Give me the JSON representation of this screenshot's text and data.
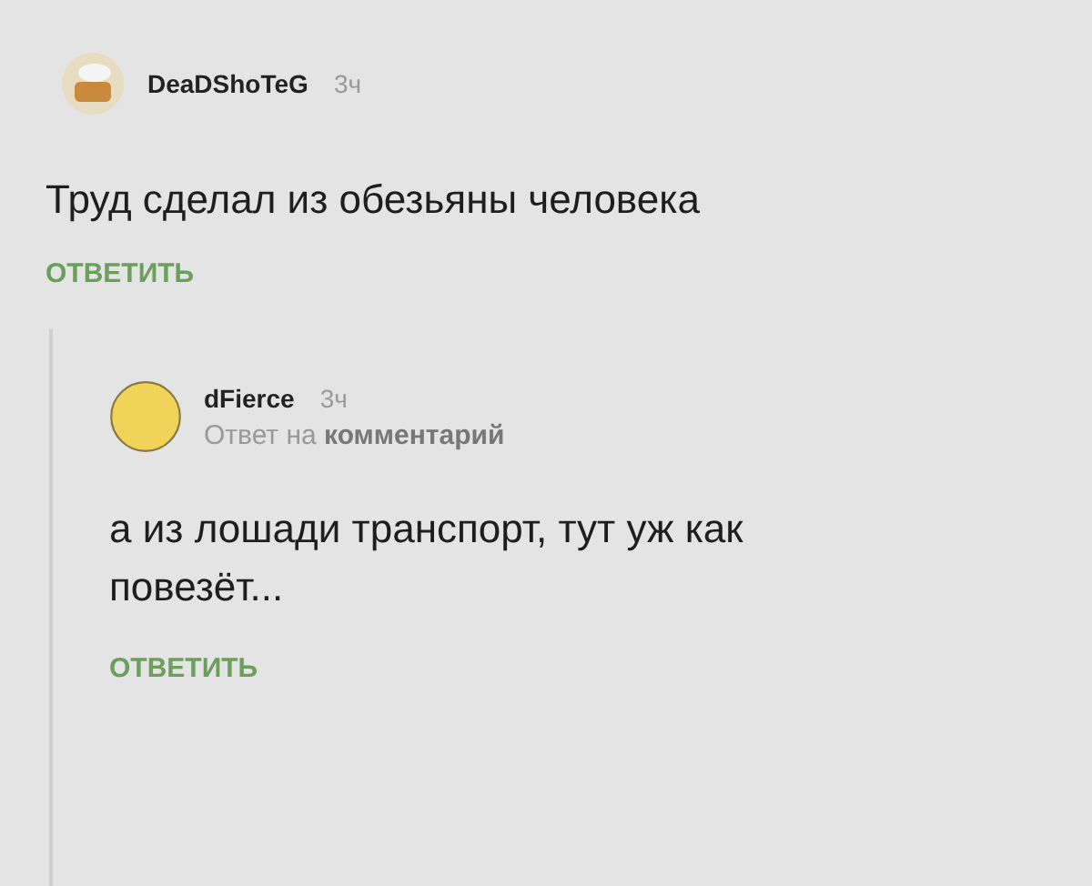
{
  "comments": [
    {
      "author": "DeaDShoTeG",
      "time": "3ч",
      "text": "Труд сделал из обезьяны человека",
      "reply_label": "ОТВЕТИТЬ",
      "avatar": {
        "kind": "cloud"
      },
      "replies": [
        {
          "author": "dFierce",
          "time": "3ч",
          "subtitle": "Ответ на **комментарий**",
          "text": "а из лошади транспорт, тут уж как повезёт...",
          "reply_label": "ОТВЕТИТЬ",
          "avatar": {
            "kind": "round"
          }
        }
      ]
    }
  ]
}
